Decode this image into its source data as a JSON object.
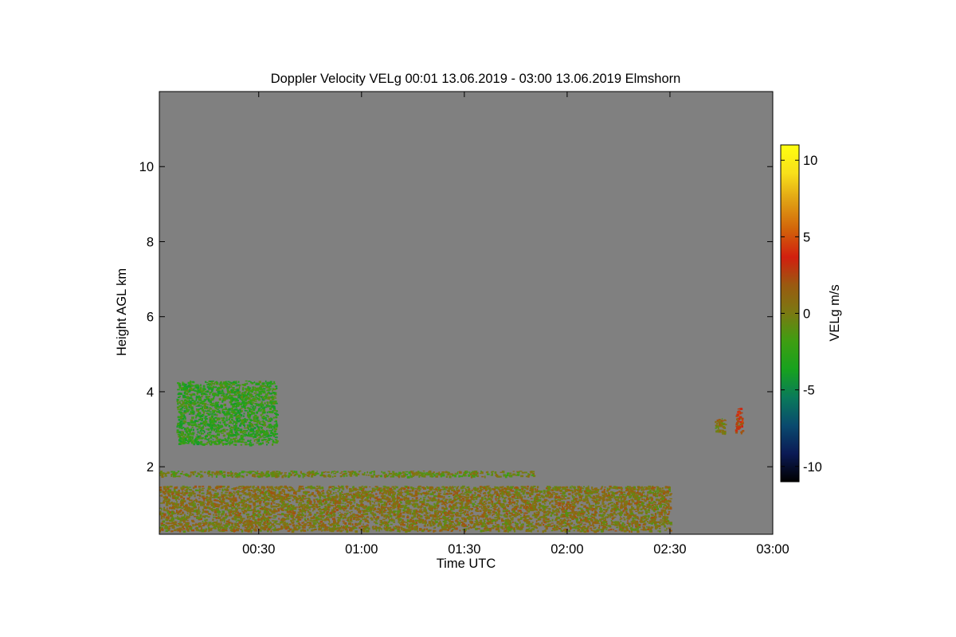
{
  "colors": {
    "background": "#ffffff",
    "plot_background": "#808080",
    "colormap": [
      "#000000",
      "#0b1a55",
      "#0a4a6e",
      "#0a7a5a",
      "#17a21e",
      "#3e9e12",
      "#7a7a12",
      "#9a5a10",
      "#d21f0f",
      "#d2640a",
      "#e0a014",
      "#f8e01a",
      "#ffff10"
    ]
  },
  "chart_data": {
    "type": "heatmap",
    "title": "Doppler Velocity VELg   00:01 13.06.2019 - 03:00 13.06.2019 Elmshorn",
    "xlabel": "Time UTC",
    "ylabel": "Height AGL km",
    "x_ticks": [
      "00:30",
      "01:00",
      "01:30",
      "02:00",
      "02:30",
      "03:00"
    ],
    "y_ticks": [
      2,
      4,
      6,
      8,
      10
    ],
    "xlim": [
      "00:01",
      "03:00"
    ],
    "ylim": [
      0.2,
      12.0
    ],
    "colorbar": {
      "label": "VELg m/s",
      "ticks": [
        10,
        5,
        0,
        -5,
        -10
      ],
      "range": [
        -11,
        11
      ]
    },
    "features": [
      {
        "time_start": "00:01",
        "time_end": "01:50",
        "height_min": 1.75,
        "height_max": 1.9,
        "velocity": -0.5
      },
      {
        "time_start": "00:01",
        "time_end": "02:30",
        "height_min": 0.3,
        "height_max": 1.5,
        "velocity": 0.5
      },
      {
        "time_start": "00:06",
        "time_end": "00:35",
        "height_min": 2.6,
        "height_max": 4.3,
        "velocity": -2.5
      },
      {
        "time_start": "02:43",
        "time_end": "02:46",
        "height_min": 2.9,
        "height_max": 3.3,
        "velocity": 0.5
      },
      {
        "time_start": "02:49",
        "time_end": "02:51",
        "height_min": 2.9,
        "height_max": 3.6,
        "velocity": 3.0
      }
    ]
  }
}
